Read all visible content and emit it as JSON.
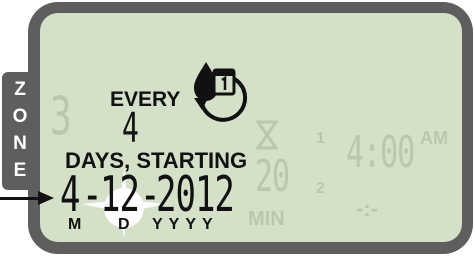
{
  "zone": {
    "letters": [
      "Z",
      "O",
      "N",
      "E"
    ],
    "number_ghost": "3"
  },
  "schedule": {
    "every_label": "EVERY",
    "interval": "4",
    "days_starting_label": "DAYS, STARTING",
    "date_display": "4-12-2012",
    "date_month": "4",
    "date_sep1": "-",
    "date_day": "12",
    "date_sep2": "-",
    "date_year": "2012",
    "date_caption_m": "M",
    "date_caption_d": "D",
    "date_caption_y": "YYYY"
  },
  "runtime": {
    "value_ghost": "20",
    "unit_ghost": "MIN",
    "hourglass_icon": "hourglass-icon"
  },
  "start_times": {
    "slot1_index": "1",
    "slot1_time": "4:00",
    "slot1_ampm": "AM",
    "slot2_index": "2",
    "slot2_time": "-:-"
  },
  "icons": {
    "interval_icon": "water-drop-calendar-cycle-icon",
    "pointer_icon": "arrow-pointer-icon"
  },
  "colors": {
    "bezel": "#5e5e5e",
    "lcd_background": "#d4e1c8",
    "segment_on": "#111111",
    "segment_off": "#b9c7ae"
  }
}
